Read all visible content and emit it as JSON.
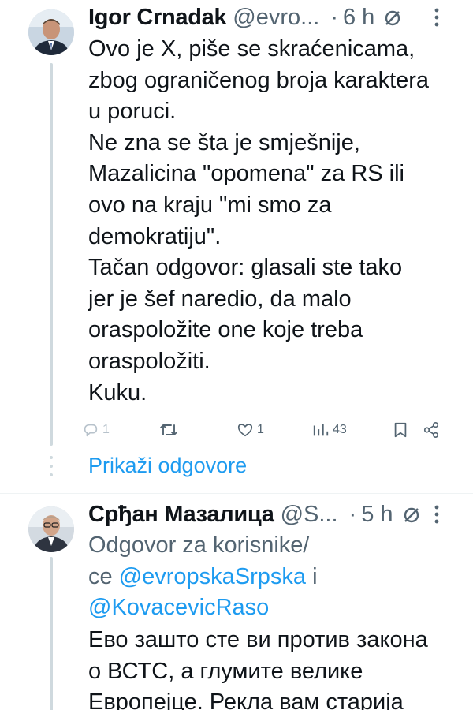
{
  "tweets": [
    {
      "author": "Igor Crnadak",
      "handle": "@evro...",
      "dot": "·",
      "time": "6 h",
      "body_lines": [
        "Ovo je X, piše se skraćenicama,",
        "zbog ograničenog broja karaktera",
        "u poruci.",
        "Ne zna se šta je smješnije,",
        "Mazalicina \"opomena\" za RS ili",
        "ovo na kraju \"mi smo za",
        "demokratiju\".",
        "Tačan odgovor: glasali ste tako",
        "jer je šef naredio, da malo",
        "oraspoložite one koje treba",
        "oraspoložiti.",
        "Kuku."
      ],
      "actions": {
        "replies": "1",
        "retweets": "",
        "likes": "1",
        "views": "43"
      },
      "show_replies": "Prikaži odgovore"
    },
    {
      "author": "Срђан Мазалица",
      "handle": "@S...",
      "dot": "·",
      "time": "5 h",
      "reply_to_line1": "Odgovor za korisnike/",
      "reply_to_line2_prefix": "ce ",
      "mention1": "@evropskaSrpska",
      "reply_to_and": " i",
      "mention2": "@KovacevicRaso",
      "body_lines": [
        "Ево зашто сте ви против закона",
        "о ВСТС, а глумите велике",
        "Европејце. Рекла вам старија"
      ]
    }
  ],
  "colors": {
    "text": "#0f1419",
    "secondary": "#536471",
    "link": "#1d9bf0",
    "thread_line": "#cfd9de"
  },
  "icons": [
    "mute-icon",
    "more-icon",
    "reply-icon",
    "retweet-icon",
    "like-icon",
    "views-icon",
    "bookmark-icon",
    "share-icon",
    "avatar"
  ]
}
